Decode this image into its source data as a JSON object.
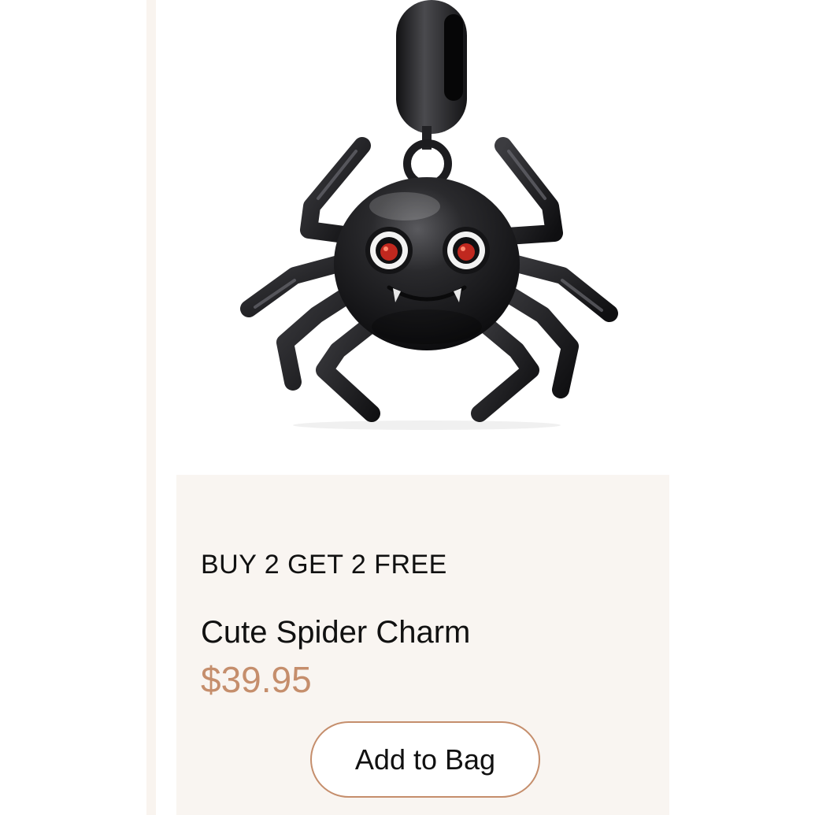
{
  "product": {
    "image_alt": "Black spider charm with red eyes",
    "promo_label": "BUY 2 GET 2 FREE",
    "title": "Cute Spider Charm",
    "price": "$39.95",
    "add_to_bag_label": "Add to Bag"
  },
  "colors": {
    "accent": "#c58e6c",
    "panel_background": "#f9f5f1",
    "text": "#111111",
    "charm_metal": "#1b1b1d",
    "eye_gem": "#c0281f"
  }
}
